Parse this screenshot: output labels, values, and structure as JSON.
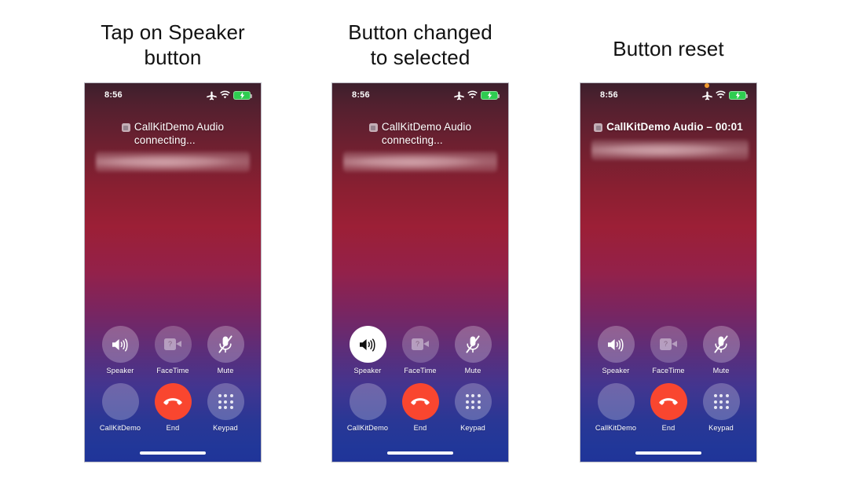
{
  "panels": [
    {
      "caption": "Tap on Speaker button",
      "caption_lines": [
        "Tap on Speaker",
        "button"
      ],
      "status": {
        "time": "8:56",
        "airplane_icon": "airplane-icon",
        "wifi_icon": "wifi-icon",
        "battery_icon": "battery-charging-icon",
        "mic_indicator": false
      },
      "call": {
        "app_icon": "app-placeholder-icon",
        "title": "CallKitDemo Audio",
        "subtitle": "connecting...",
        "two_line": true,
        "redacted_label": "redacted-caller-name"
      },
      "controls": [
        [
          {
            "name": "speaker",
            "label": "Speaker",
            "icon": "speaker-icon",
            "state": "normal"
          },
          {
            "name": "facetime",
            "label": "FaceTime",
            "icon": "video-camera-placeholder-icon",
            "state": "dim"
          },
          {
            "name": "mute",
            "label": "Mute",
            "icon": "mic-off-icon",
            "state": "normal"
          }
        ],
        [
          {
            "name": "callkitdemo",
            "label": "CallKitDemo",
            "icon": "app-blank-icon",
            "state": "plain"
          },
          {
            "name": "end",
            "label": "End",
            "icon": "end-call-icon",
            "state": "end"
          },
          {
            "name": "keypad",
            "label": "Keypad",
            "icon": "keypad-icon",
            "state": "keypad"
          }
        ]
      ]
    },
    {
      "caption": "Button changed to selected",
      "caption_lines": [
        "Button changed",
        "to selected"
      ],
      "status": {
        "time": "8:56",
        "airplane_icon": "airplane-icon",
        "wifi_icon": "wifi-icon",
        "battery_icon": "battery-charging-icon",
        "mic_indicator": false
      },
      "call": {
        "app_icon": "app-placeholder-icon",
        "title": "CallKitDemo Audio",
        "subtitle": "connecting...",
        "two_line": true,
        "redacted_label": "redacted-caller-name"
      },
      "controls": [
        [
          {
            "name": "speaker",
            "label": "Speaker",
            "icon": "speaker-icon",
            "state": "selected"
          },
          {
            "name": "facetime",
            "label": "FaceTime",
            "icon": "video-camera-placeholder-icon",
            "state": "dim"
          },
          {
            "name": "mute",
            "label": "Mute",
            "icon": "mic-off-icon",
            "state": "normal"
          }
        ],
        [
          {
            "name": "callkitdemo",
            "label": "CallKitDemo",
            "icon": "app-blank-icon",
            "state": "plain"
          },
          {
            "name": "end",
            "label": "End",
            "icon": "end-call-icon",
            "state": "end"
          },
          {
            "name": "keypad",
            "label": "Keypad",
            "icon": "keypad-icon",
            "state": "keypad"
          }
        ]
      ]
    },
    {
      "caption": "Button reset",
      "caption_lines": [
        "Button reset"
      ],
      "status": {
        "time": "8:56",
        "airplane_icon": "airplane-icon",
        "wifi_icon": "wifi-icon",
        "battery_icon": "battery-charging-icon",
        "mic_indicator": true
      },
      "call": {
        "app_icon": "app-placeholder-icon",
        "title": "CallKitDemo Audio – 00:01",
        "subtitle": "",
        "two_line": false,
        "redacted_label": "redacted-caller-name"
      },
      "controls": [
        [
          {
            "name": "speaker",
            "label": "Speaker",
            "icon": "speaker-icon",
            "state": "normal"
          },
          {
            "name": "facetime",
            "label": "FaceTime",
            "icon": "video-camera-placeholder-icon",
            "state": "dim"
          },
          {
            "name": "mute",
            "label": "Mute",
            "icon": "mic-off-icon",
            "state": "normal"
          }
        ],
        [
          {
            "name": "callkitdemo",
            "label": "CallKitDemo",
            "icon": "app-blank-icon",
            "state": "plain"
          },
          {
            "name": "end",
            "label": "End",
            "icon": "end-call-icon",
            "state": "end"
          },
          {
            "name": "keypad",
            "label": "Keypad",
            "icon": "keypad-icon",
            "state": "keypad"
          }
        ]
      ]
    }
  ],
  "facetime_glyph": "?",
  "colors": {
    "background": "#ffffff",
    "caption_text": "#111111",
    "end_button": "#f9462f",
    "battery_green": "#2ecc50",
    "mic_dot_orange": "#f29b2e",
    "selected_button": "#ffffff",
    "screen_gradient_top": "#3d1f2c",
    "screen_gradient_mid": "#9c1f36",
    "screen_gradient_bottom": "#1f3499"
  }
}
